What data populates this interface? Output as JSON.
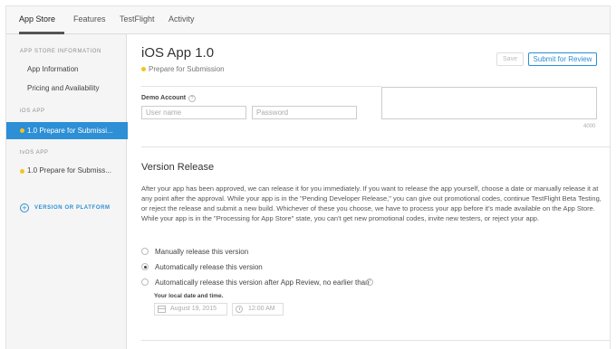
{
  "tabs": [
    {
      "label": "App Store",
      "active": true
    },
    {
      "label": "Features"
    },
    {
      "label": "TestFlight"
    },
    {
      "label": "Activity"
    }
  ],
  "sidebar": {
    "info_heading": "APP STORE INFORMATION",
    "info_items": [
      "App Information",
      "Pricing and Availability"
    ],
    "ios_heading": "iOS APP",
    "ios_item": "1.0 Prepare for Submissi...",
    "tvos_heading": "tvOS APP",
    "tvos_item": "1.0 Prepare for Submiss...",
    "add_version": "VERSION OR PLATFORM"
  },
  "header": {
    "title": "iOS App 1.0",
    "status": "Prepare for Submission",
    "save_label": "Save",
    "submit_label": "Submit for Review"
  },
  "demo": {
    "label": "Demo Account",
    "help": "?",
    "username_placeholder": "User name",
    "password_placeholder": "Password",
    "counter": "4000"
  },
  "release": {
    "title": "Version Release",
    "description": "After your app has been approved, we can release it for you immediately. If you want to release the app yourself, choose a date or manually release it at any point after the approval. While your app is in the \"Pending Developer Release,\" you can give out promotional codes, continue TestFlight Beta Testing, or reject the release and submit a new build. Whichever of these you choose, we have to process your app before it's made available on the App Store. While your app is in the \"Processing for App Store\" state, you can't get new promotional codes, invite new testers, or reject your app.",
    "options": [
      {
        "label": "Manually release this version",
        "checked": false
      },
      {
        "label": "Automatically release this version",
        "checked": true
      },
      {
        "label": "Automatically release this version after App Review, no earlier than",
        "checked": false
      }
    ],
    "local_label": "Your local date and time.",
    "date_value": "August 19, 2015",
    "time_value": "12:00 AM"
  },
  "colors": {
    "accent": "#2d8fd5",
    "status_dot": "#f4c51c"
  }
}
